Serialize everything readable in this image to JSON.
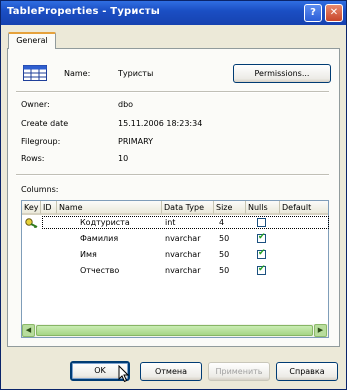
{
  "window": {
    "title": "TableProperties - Туристы",
    "help_glyph": "?",
    "close_glyph": "✕"
  },
  "tabs": [
    {
      "label": "General"
    }
  ],
  "general": {
    "name_label": "Name:",
    "name_value": "Туристы",
    "permissions_label": "Permissions...",
    "owner_label": "Owner:",
    "owner_value": "dbo",
    "create_date_label": "Create date",
    "create_date_value": "15.11.2006 18:23:34",
    "filegroup_label": "Filegroup:",
    "filegroup_value": "PRIMARY",
    "rows_label": "Rows:",
    "rows_value": "10",
    "columns_label": "Columns:"
  },
  "grid": {
    "headers": [
      "Key",
      "ID",
      "Name",
      "Data Type",
      "Size",
      "Nulls",
      "Default"
    ],
    "rows": [
      {
        "key": true,
        "name": "Кодтуриста",
        "type": "int",
        "size": "4",
        "nulls": false
      },
      {
        "key": false,
        "name": "Фамилия",
        "type": "nvarchar",
        "size": "50",
        "nulls": true
      },
      {
        "key": false,
        "name": "Имя",
        "type": "nvarchar",
        "size": "50",
        "nulls": true
      },
      {
        "key": false,
        "name": "Отчество",
        "type": "nvarchar",
        "size": "50",
        "nulls": true
      }
    ]
  },
  "buttons": {
    "ok": "OK",
    "cancel": "Отмена",
    "apply": "Применить",
    "help": "Справка"
  },
  "icons": {
    "table": "table-icon",
    "key": "key-icon",
    "check": "checkmark-icon"
  },
  "colors": {
    "titlebar": "#1b4fc4",
    "tab_accent": "#e6a23c",
    "check_green": "#21a121",
    "scrollbar": "#b8dd9d"
  }
}
